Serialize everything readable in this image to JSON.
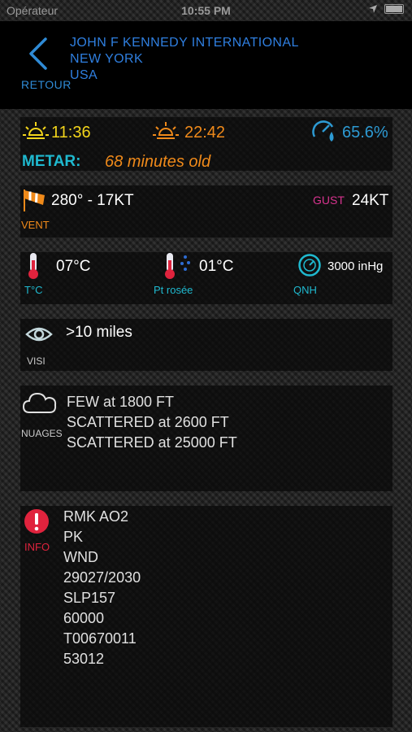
{
  "status_bar": {
    "carrier": "Opérateur",
    "time": "10:55 PM",
    "icons": [
      "wifi-icon",
      "location-arrow-icon",
      "battery-icon"
    ]
  },
  "header": {
    "back_label": "RETOUR",
    "airport_name": "JOHN F KENNEDY INTERNATIONAL",
    "city": "NEW YORK",
    "country": "USA"
  },
  "sun": {
    "sunrise": "11:36",
    "sunset": "22:42",
    "humidity": "65.6%",
    "metar_label": "METAR:",
    "metar_age": "68 minutes old"
  },
  "wind": {
    "value": "280° - 17KT",
    "label": "VENT",
    "gust_label": "GUST",
    "gust_value": "24KT"
  },
  "temps": {
    "temperature": "07°C",
    "temperature_label": "T°C",
    "dewpoint": "01°C",
    "dewpoint_label": "Pt rosée",
    "pressure": "3000 inHg",
    "pressure_label": "QNH"
  },
  "visibility": {
    "value": ">10 miles",
    "label": "VISI"
  },
  "clouds": {
    "label": "NUAGES",
    "layers": [
      "FEW at 1800 FT",
      "SCATTERED at 2600 FT",
      "SCATTERED at 25000 FT"
    ]
  },
  "info": {
    "label": "INFO",
    "lines": [
      "RMK AO2",
      "PK",
      "WND",
      "29027/2030",
      "SLP157",
      "60000",
      "T00670011",
      "53012"
    ]
  },
  "colors": {
    "accent_blue": "#2f7fe0",
    "cyan": "#1fb9cf",
    "orange": "#f08a1a",
    "yellow": "#f3d51b",
    "pink": "#d8338f",
    "red": "#e0233d"
  }
}
